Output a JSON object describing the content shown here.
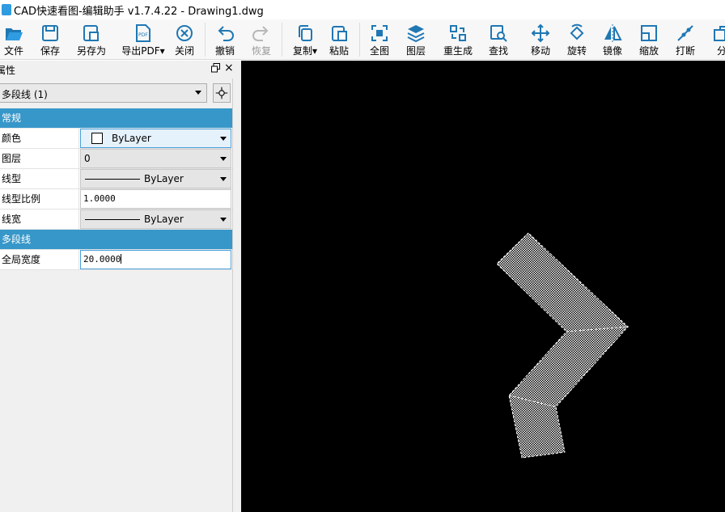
{
  "window": {
    "title": "CAD快速看图-编辑助手 v1.7.4.22 - Drawing1.dwg"
  },
  "toolbar": {
    "file": "文件",
    "save": "保存",
    "save_as": "另存为",
    "export_pdf": "导出PDF",
    "close": "关闭",
    "undo": "撤销",
    "redo": "恢复",
    "copy": "复制",
    "paste": "粘贴",
    "full_view": "全图",
    "layers": "图层",
    "regen": "重生成",
    "find": "查找",
    "move": "移动",
    "rotate": "旋转",
    "mirror": "镜像",
    "scale": "缩放",
    "break": "打断",
    "partial": "分"
  },
  "panel": {
    "title": "属性",
    "object_selector": "多段线 (1)",
    "sections": {
      "general": "常规",
      "polyline": "多段线"
    },
    "rows": {
      "color": {
        "label": "颜色",
        "value": "ByLayer"
      },
      "layer": {
        "label": "图层",
        "value": "0"
      },
      "linetype": {
        "label": "线型",
        "value": "ByLayer"
      },
      "linetype_scale": {
        "label": "线型比例",
        "value": "1.0000"
      },
      "lineweight": {
        "label": "线宽",
        "value": "ByLayer"
      },
      "global_width": {
        "label": "全局宽度",
        "value": "20.0000"
      }
    }
  },
  "colors": {
    "accent": "#3797c9",
    "canvas_bg": "#000000",
    "entity": "#ffffff"
  }
}
